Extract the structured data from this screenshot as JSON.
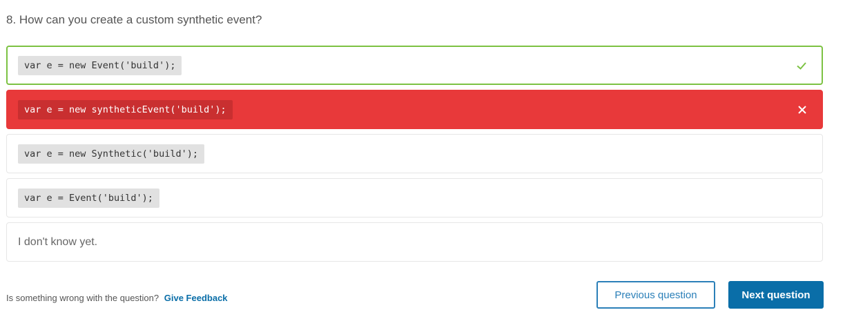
{
  "question": {
    "text": "8. How can you create a custom synthetic event?"
  },
  "options": [
    {
      "code": "var e = new Event('build');",
      "state": "correct",
      "icon": "check-icon"
    },
    {
      "code": "var e = new syntheticEvent('build');",
      "state": "wrong",
      "icon": "close-icon"
    },
    {
      "code": "var e = new Synthetic('build');",
      "state": "neutral"
    },
    {
      "code": "var e = Event('build');",
      "state": "neutral"
    },
    {
      "text": "I don't know yet.",
      "state": "neutral"
    }
  ],
  "footer": {
    "feedback_prompt": "Is something wrong with the question?",
    "feedback_link": "Give Feedback",
    "prev_label": "Previous question",
    "next_label": "Next question"
  },
  "colors": {
    "correct": "#7cc242",
    "wrong": "#e8393a",
    "accent": "#0a6ea8"
  }
}
